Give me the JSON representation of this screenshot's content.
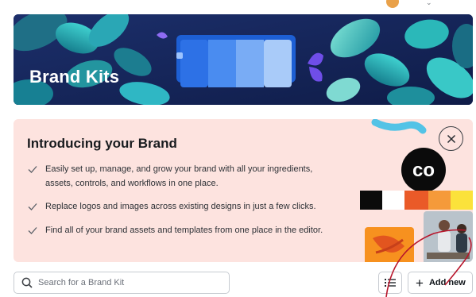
{
  "hero": {
    "title": "Brand Kits"
  },
  "intro": {
    "title": "Introducing your Brand",
    "items": [
      "Easily set up, manage, and grow your brand with all your ingredients, assets, controls, and workflows in one place.",
      "Replace logos and images across existing designs in just a few clicks.",
      "Find all of your brand assets and templates from one place in the editor."
    ],
    "logo_text": "co",
    "swatches": [
      "#0b0b0b",
      "#ffffff",
      "#ea5a28",
      "#f59a3a",
      "#fbe23b"
    ]
  },
  "toolbar": {
    "search_placeholder": "Search for a Brand Kit",
    "add_label": "Add new"
  },
  "icons": {
    "close": "close-icon",
    "check": "check-icon",
    "search": "search-icon",
    "list_view": "list-view-icon",
    "plus": "plus-icon"
  },
  "colors": {
    "intro_bg": "#fde3df",
    "annotation": "#b8162c",
    "hero_teal": "#2fb7c4"
  }
}
